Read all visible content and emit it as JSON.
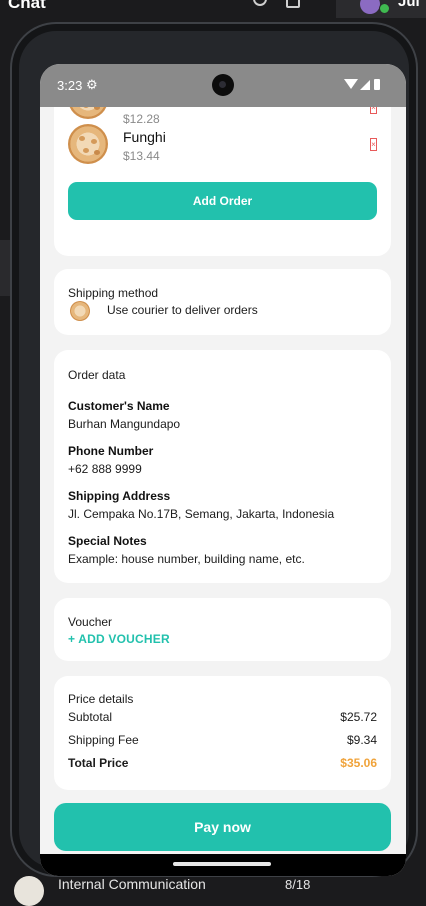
{
  "host": {
    "title": "Chat",
    "user_initials": "Jul",
    "bottom_item": {
      "label": "Internal Communication",
      "count": "8/18"
    }
  },
  "status_bar": {
    "time": "3:23"
  },
  "order_items": [
    {
      "name": "",
      "price": "$12.28"
    },
    {
      "name": "Funghi",
      "price": "$13.44"
    }
  ],
  "add_order_label": "Add Order",
  "shipping": {
    "title": "Shipping method",
    "option": "Use courier to deliver orders"
  },
  "order_data": {
    "title": "Order data",
    "fields": [
      {
        "label": "Customer's Name",
        "value": "Burhan Mangundapo"
      },
      {
        "label": "Phone Number",
        "value": "+62 888 9999"
      },
      {
        "label": "Shipping Address",
        "value": "Jl. Cempaka No.17B, Semang, Jakarta, Indonesia"
      },
      {
        "label": "Special Notes",
        "value": "Example: house number, building name, etc."
      }
    ]
  },
  "voucher": {
    "title": "Voucher",
    "add_label": "+ ADD VOUCHER"
  },
  "price_details": {
    "title": "Price details",
    "subtotal_label": "Subtotal",
    "subtotal": "$25.72",
    "shipping_label": "Shipping Fee",
    "shipping": "$9.34",
    "total_label": "Total Price",
    "total": "$35.06"
  },
  "pay_label": "Pay now",
  "colors": {
    "accent": "#22c1ad",
    "total_price": "#f0a33a",
    "delete": "#e85a5a"
  }
}
